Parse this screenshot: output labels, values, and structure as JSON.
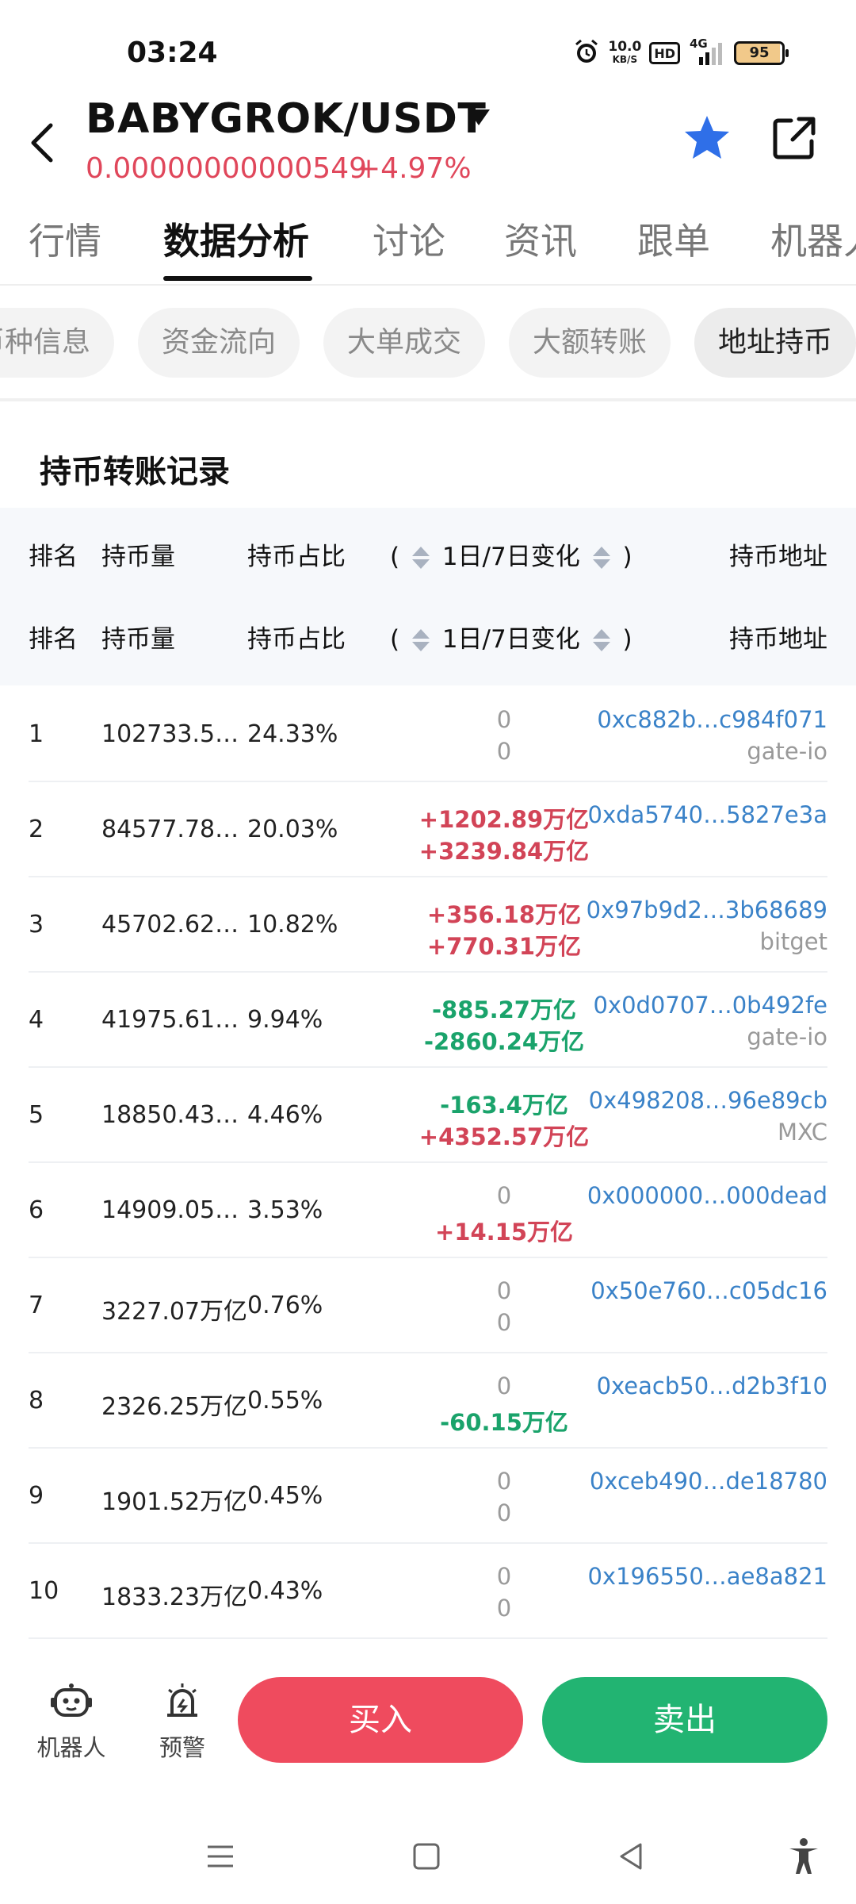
{
  "status_bar": {
    "time": "03:24",
    "net_speed_value": "10.0",
    "net_speed_unit": "KB/S",
    "hd_label": "HD",
    "network_label": "4G",
    "battery_level": "95"
  },
  "header": {
    "pair": "BABYGROK/USDT",
    "price": "0.00000000000549",
    "change": "+4.97%"
  },
  "tabs": [
    {
      "label": "行情"
    },
    {
      "label": "数据分析"
    },
    {
      "label": "讨论"
    },
    {
      "label": "资讯"
    },
    {
      "label": "跟单"
    },
    {
      "label": "机器人"
    }
  ],
  "chips": [
    {
      "label": "币种信息"
    },
    {
      "label": "资金流向"
    },
    {
      "label": "大单成交"
    },
    {
      "label": "大额转账"
    },
    {
      "label": "地址持币"
    }
  ],
  "section_title": "持币转账记录",
  "table_headers": {
    "rank": "排名",
    "amount": "持币量",
    "share": "持币占比",
    "paren_open": "(",
    "change": "1日/7日变化",
    "paren_close": ")",
    "address": "持币地址"
  },
  "rows": [
    {
      "rank": "1",
      "amount": "102733.5…",
      "share": "24.33%",
      "d1": "0",
      "d7": "0",
      "address": "0xc882b…c984f071",
      "label": "gate-io"
    },
    {
      "rank": "2",
      "amount": "84577.78…",
      "share": "20.03%",
      "d1": "+1202.89万亿",
      "d7": "+3239.84万亿",
      "address": "0xda5740…5827e3a",
      "label": ""
    },
    {
      "rank": "3",
      "amount": "45702.62…",
      "share": "10.82%",
      "d1": "+356.18万亿",
      "d7": "+770.31万亿",
      "address": "0x97b9d2…3b68689",
      "label": "bitget"
    },
    {
      "rank": "4",
      "amount": "41975.61…",
      "share": "9.94%",
      "d1": "-885.27万亿",
      "d7": "-2860.24万亿",
      "address": "0x0d0707…0b492fe",
      "label": "gate-io"
    },
    {
      "rank": "5",
      "amount": "18850.43…",
      "share": "4.46%",
      "d1": "-163.4万亿",
      "d7": "+4352.57万亿",
      "address": "0x498208…96e89cb",
      "label": "MXC"
    },
    {
      "rank": "6",
      "amount": "14909.05…",
      "share": "3.53%",
      "d1": "0",
      "d7": "+14.15万亿",
      "address": "0x000000…000dead",
      "label": ""
    },
    {
      "rank": "7",
      "amount": "3227.07万亿",
      "share": "0.76%",
      "d1": "0",
      "d7": "0",
      "address": "0x50e760…c05dc16",
      "label": ""
    },
    {
      "rank": "8",
      "amount": "2326.25万亿",
      "share": "0.55%",
      "d1": "0",
      "d7": "-60.15万亿",
      "address": "0xeacb50…d2b3f10",
      "label": ""
    },
    {
      "rank": "9",
      "amount": "1901.52万亿",
      "share": "0.45%",
      "d1": "0",
      "d7": "0",
      "address": "0xceb490…de18780",
      "label": ""
    },
    {
      "rank": "10",
      "amount": "1833.23万亿",
      "share": "0.43%",
      "d1": "0",
      "d7": "0",
      "address": "0x196550…ae8a821",
      "label": ""
    }
  ],
  "bottom_bar": {
    "robot_label": "机器人",
    "alert_label": "预警",
    "buy_label": "买入",
    "sell_label": "卖出"
  },
  "colors": {
    "up": "#d24457",
    "down": "#1aa36b",
    "address": "#3a82c8",
    "star": "#2f6fe8",
    "buy": "#ef4b5e",
    "sell": "#22b472"
  }
}
